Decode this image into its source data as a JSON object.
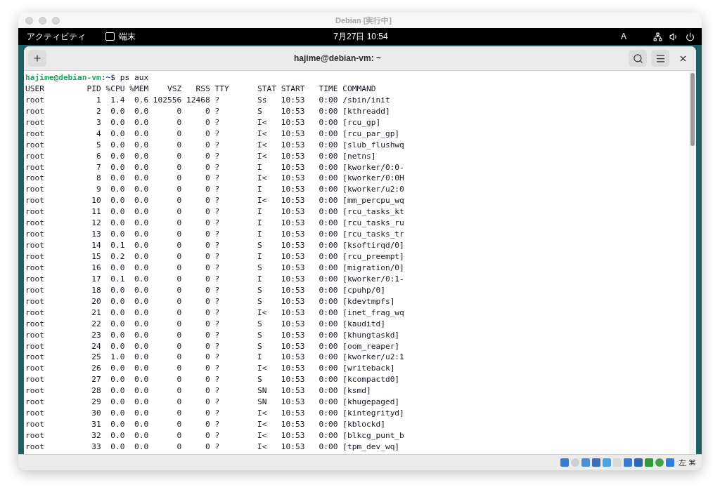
{
  "host_window": {
    "title": "Debian [実行中]"
  },
  "top_bar": {
    "activities": "アクティビティ",
    "app": "端末",
    "clock": "7月27日 10:54",
    "input_method": "A"
  },
  "terminal": {
    "title": "hajime@debian-vm: ~",
    "prompt": {
      "user_host": "hajime@debian-vm",
      "separator": ":",
      "path": "~",
      "symbol": "$",
      "command": "ps aux"
    },
    "columns": [
      "USER",
      "PID",
      "%CPU",
      "%MEM",
      "VSZ",
      "RSS",
      "TTY",
      "STAT",
      "START",
      "TIME",
      "COMMAND"
    ],
    "rows": [
      [
        "root",
        "1",
        "1.4",
        "0.6",
        "102556",
        "12468",
        "?",
        "Ss",
        "10:53",
        "0:00",
        "/sbin/init"
      ],
      [
        "root",
        "2",
        "0.0",
        "0.0",
        "0",
        "0",
        "?",
        "S",
        "10:53",
        "0:00",
        "[kthreadd]"
      ],
      [
        "root",
        "3",
        "0.0",
        "0.0",
        "0",
        "0",
        "?",
        "I<",
        "10:53",
        "0:00",
        "[rcu_gp]"
      ],
      [
        "root",
        "4",
        "0.0",
        "0.0",
        "0",
        "0",
        "?",
        "I<",
        "10:53",
        "0:00",
        "[rcu_par_gp]"
      ],
      [
        "root",
        "5",
        "0.0",
        "0.0",
        "0",
        "0",
        "?",
        "I<",
        "10:53",
        "0:00",
        "[slub_flushwq"
      ],
      [
        "root",
        "6",
        "0.0",
        "0.0",
        "0",
        "0",
        "?",
        "I<",
        "10:53",
        "0:00",
        "[netns]"
      ],
      [
        "root",
        "7",
        "0.0",
        "0.0",
        "0",
        "0",
        "?",
        "I",
        "10:53",
        "0:00",
        "[kworker/0:0-"
      ],
      [
        "root",
        "8",
        "0.0",
        "0.0",
        "0",
        "0",
        "?",
        "I<",
        "10:53",
        "0:00",
        "[kworker/0:0H"
      ],
      [
        "root",
        "9",
        "0.0",
        "0.0",
        "0",
        "0",
        "?",
        "I",
        "10:53",
        "0:00",
        "[kworker/u2:0"
      ],
      [
        "root",
        "10",
        "0.0",
        "0.0",
        "0",
        "0",
        "?",
        "I<",
        "10:53",
        "0:00",
        "[mm_percpu_wq"
      ],
      [
        "root",
        "11",
        "0.0",
        "0.0",
        "0",
        "0",
        "?",
        "I",
        "10:53",
        "0:00",
        "[rcu_tasks_kt"
      ],
      [
        "root",
        "12",
        "0.0",
        "0.0",
        "0",
        "0",
        "?",
        "I",
        "10:53",
        "0:00",
        "[rcu_tasks_ru"
      ],
      [
        "root",
        "13",
        "0.0",
        "0.0",
        "0",
        "0",
        "?",
        "I",
        "10:53",
        "0:00",
        "[rcu_tasks_tr"
      ],
      [
        "root",
        "14",
        "0.1",
        "0.0",
        "0",
        "0",
        "?",
        "S",
        "10:53",
        "0:00",
        "[ksoftirqd/0]"
      ],
      [
        "root",
        "15",
        "0.2",
        "0.0",
        "0",
        "0",
        "?",
        "I",
        "10:53",
        "0:00",
        "[rcu_preempt]"
      ],
      [
        "root",
        "16",
        "0.0",
        "0.0",
        "0",
        "0",
        "?",
        "S",
        "10:53",
        "0:00",
        "[migration/0]"
      ],
      [
        "root",
        "17",
        "0.1",
        "0.0",
        "0",
        "0",
        "?",
        "I",
        "10:53",
        "0:00",
        "[kworker/0:1-"
      ],
      [
        "root",
        "18",
        "0.0",
        "0.0",
        "0",
        "0",
        "?",
        "S",
        "10:53",
        "0:00",
        "[cpuhp/0]"
      ],
      [
        "root",
        "20",
        "0.0",
        "0.0",
        "0",
        "0",
        "?",
        "S",
        "10:53",
        "0:00",
        "[kdevtmpfs]"
      ],
      [
        "root",
        "21",
        "0.0",
        "0.0",
        "0",
        "0",
        "?",
        "I<",
        "10:53",
        "0:00",
        "[inet_frag_wq"
      ],
      [
        "root",
        "22",
        "0.0",
        "0.0",
        "0",
        "0",
        "?",
        "S",
        "10:53",
        "0:00",
        "[kauditd]"
      ],
      [
        "root",
        "23",
        "0.0",
        "0.0",
        "0",
        "0",
        "?",
        "S",
        "10:53",
        "0:00",
        "[khungtaskd]"
      ],
      [
        "root",
        "24",
        "0.0",
        "0.0",
        "0",
        "0",
        "?",
        "S",
        "10:53",
        "0:00",
        "[oom_reaper]"
      ],
      [
        "root",
        "25",
        "1.0",
        "0.0",
        "0",
        "0",
        "?",
        "I",
        "10:53",
        "0:00",
        "[kworker/u2:1"
      ],
      [
        "root",
        "26",
        "0.0",
        "0.0",
        "0",
        "0",
        "?",
        "I<",
        "10:53",
        "0:00",
        "[writeback]"
      ],
      [
        "root",
        "27",
        "0.0",
        "0.0",
        "0",
        "0",
        "?",
        "S",
        "10:53",
        "0:00",
        "[kcompactd0]"
      ],
      [
        "root",
        "28",
        "0.0",
        "0.0",
        "0",
        "0",
        "?",
        "SN",
        "10:53",
        "0:00",
        "[ksmd]"
      ],
      [
        "root",
        "29",
        "0.0",
        "0.0",
        "0",
        "0",
        "?",
        "SN",
        "10:53",
        "0:00",
        "[khugepaged]"
      ],
      [
        "root",
        "30",
        "0.0",
        "0.0",
        "0",
        "0",
        "?",
        "I<",
        "10:53",
        "0:00",
        "[kintegrityd]"
      ],
      [
        "root",
        "31",
        "0.0",
        "0.0",
        "0",
        "0",
        "?",
        "I<",
        "10:53",
        "0:00",
        "[kblockd]"
      ],
      [
        "root",
        "32",
        "0.0",
        "0.0",
        "0",
        "0",
        "?",
        "I<",
        "10:53",
        "0:00",
        "[blkcg_punt_b"
      ],
      [
        "root",
        "33",
        "0.0",
        "0.0",
        "0",
        "0",
        "?",
        "I<",
        "10:53",
        "0:00",
        "[tpm_dev_wq]"
      ]
    ]
  },
  "status_bar": {
    "host_key": "左 ⌘"
  }
}
